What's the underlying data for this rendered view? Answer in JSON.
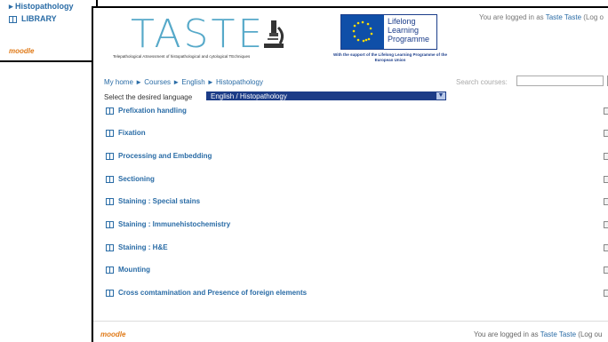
{
  "background_window": {
    "items": [
      "▸ Histopathology",
      "LIBRARY"
    ],
    "footer_logo": "moodle"
  },
  "header": {
    "logo_text": "TASTE",
    "logo_subtitle": "Telepathological ASsessment of histopathological and cytological TEchniques",
    "eu_lines": [
      "Lifelong",
      "Learning",
      "Programme"
    ],
    "eu_support": "With the support of the Lifelong Learning Programme of the European Union",
    "login_prefix": "You are logged in as ",
    "login_user": "Taste Taste",
    "login_suffix": " (Log o"
  },
  "breadcrumb": "My home ► Courses ► English ► Histopathology",
  "search": {
    "label": "Search courses:",
    "placeholder": "",
    "go_label": "G"
  },
  "language": {
    "label": "Select the desired language",
    "selected": "English / Histopathology"
  },
  "courses": [
    {
      "label": "Prefixation handling"
    },
    {
      "label": "Fixation"
    },
    {
      "label": "Processing and Embedding"
    },
    {
      "label": "Sectioning"
    },
    {
      "label": "Staining : Special stains"
    },
    {
      "label": "Staining : Immunehistochemistry"
    },
    {
      "label": "Staining : H&E"
    },
    {
      "label": "Mounting"
    },
    {
      "label": "Cross comtamination and Presence of foreign elements"
    }
  ],
  "footer": {
    "logo": "moodle",
    "login_prefix": "You are logged in as ",
    "login_user": "Taste Taste",
    "login_suffix": " (Log ou"
  },
  "colors": {
    "link": "#2a6ca6",
    "logo": "#56a9c9",
    "select_bg": "#1c3c87",
    "moodle": "#e07a18"
  }
}
